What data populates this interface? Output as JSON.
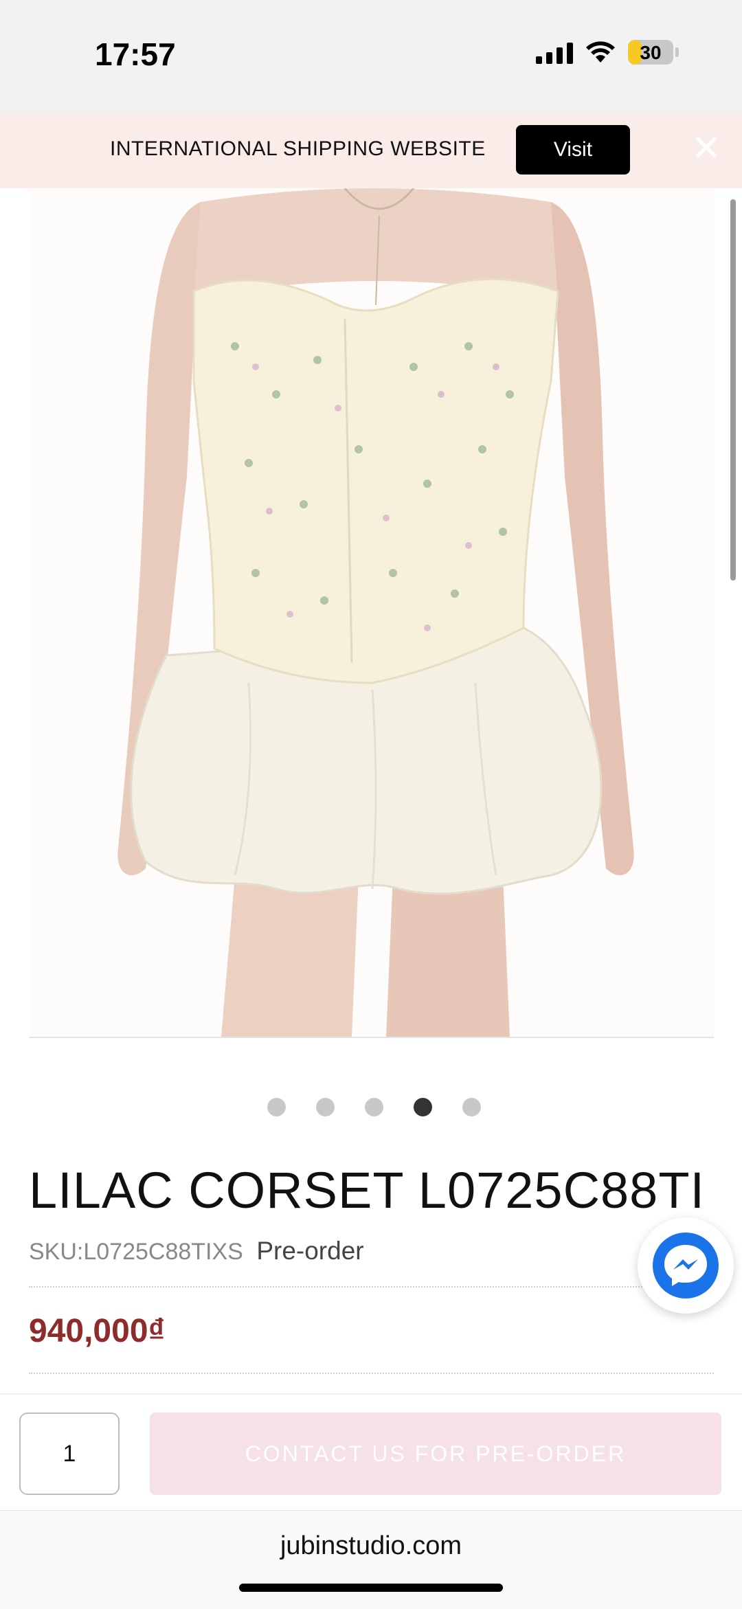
{
  "status_bar": {
    "time": "17:57",
    "battery_level": "30"
  },
  "banner": {
    "text": "INTERNATIONAL SHIPPING WEBSITE",
    "visit_label": "Visit",
    "close_icon": "close-icon"
  },
  "product": {
    "image_alt": "woman wearing floral strapless corset top with white bubble skirt",
    "carousel": {
      "total": 5,
      "active_index": 3
    },
    "title": "LILAC CORSET L0725C88TI",
    "sku_label": "SKU:",
    "sku_value": "L0725C88TIXS",
    "availability": "Pre-order",
    "price": "940,000₫"
  },
  "cart": {
    "quantity": "1",
    "button_label": "CONTACT US FOR PRE-ORDER"
  },
  "browser": {
    "url": "jubinstudio.com"
  },
  "colors": {
    "price": "#8e2b2b",
    "banner_bg": "#f9ece9",
    "button_bg": "#f6e1e6",
    "messenger": "#1a73e8"
  }
}
